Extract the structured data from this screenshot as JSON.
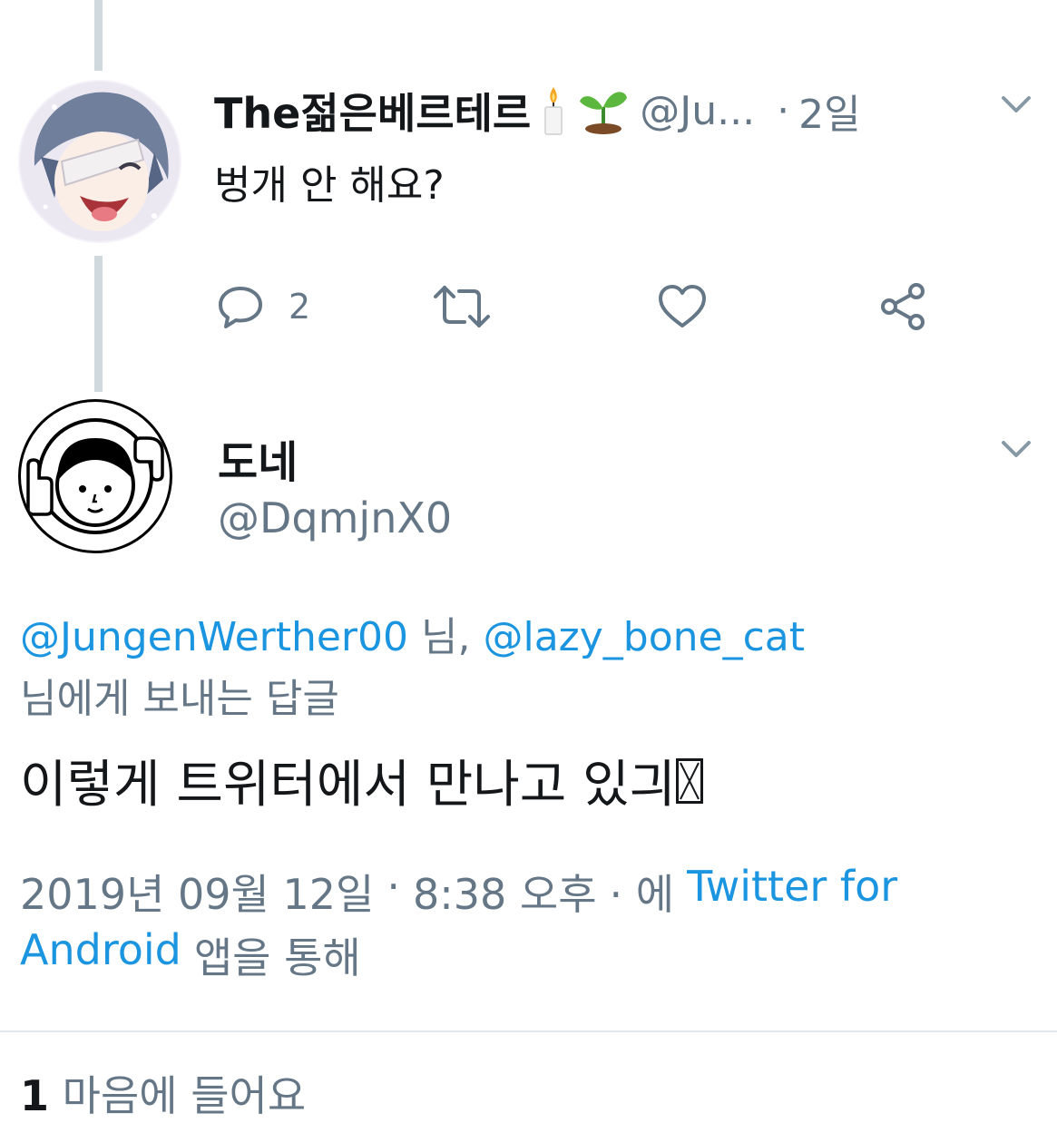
{
  "previous_tweet": {
    "author_name": "The젊은베르테르",
    "author_emojis": [
      "candle",
      "seedling"
    ],
    "handle": "@Ju...",
    "separator": "·",
    "time_ago": "2일",
    "text": "벙개 안 해요?",
    "actions": {
      "reply_count": "2"
    }
  },
  "main_tweet": {
    "author_name": "도네",
    "handle": "@DqmjnX0",
    "reply_to": {
      "mentions": [
        "@JungenWerther00",
        "@lazy_bone_cat"
      ],
      "suffix_1": "님,",
      "suffix_2": "님에게 보내는 답글"
    },
    "text": "이렇게 트위터에서 만나고 있긔 ",
    "date": "2019년 09월 12일",
    "dot": "·",
    "time": "8:38 오후",
    "via_prefix": "· 에",
    "source_part1": "Twitter for",
    "source_part2": "Android",
    "via_suffix": "앱을 통해",
    "likes_count": "1",
    "likes_label": "마음에 들어요"
  },
  "icons": [
    "reply-icon",
    "retweet-icon",
    "like-icon",
    "share-icon",
    "chevron-down-icon"
  ],
  "colors": {
    "link": "#1b95e0",
    "secondary_text": "#657786",
    "thread_line": "#cfd9de",
    "divider": "#e1e8ed"
  }
}
